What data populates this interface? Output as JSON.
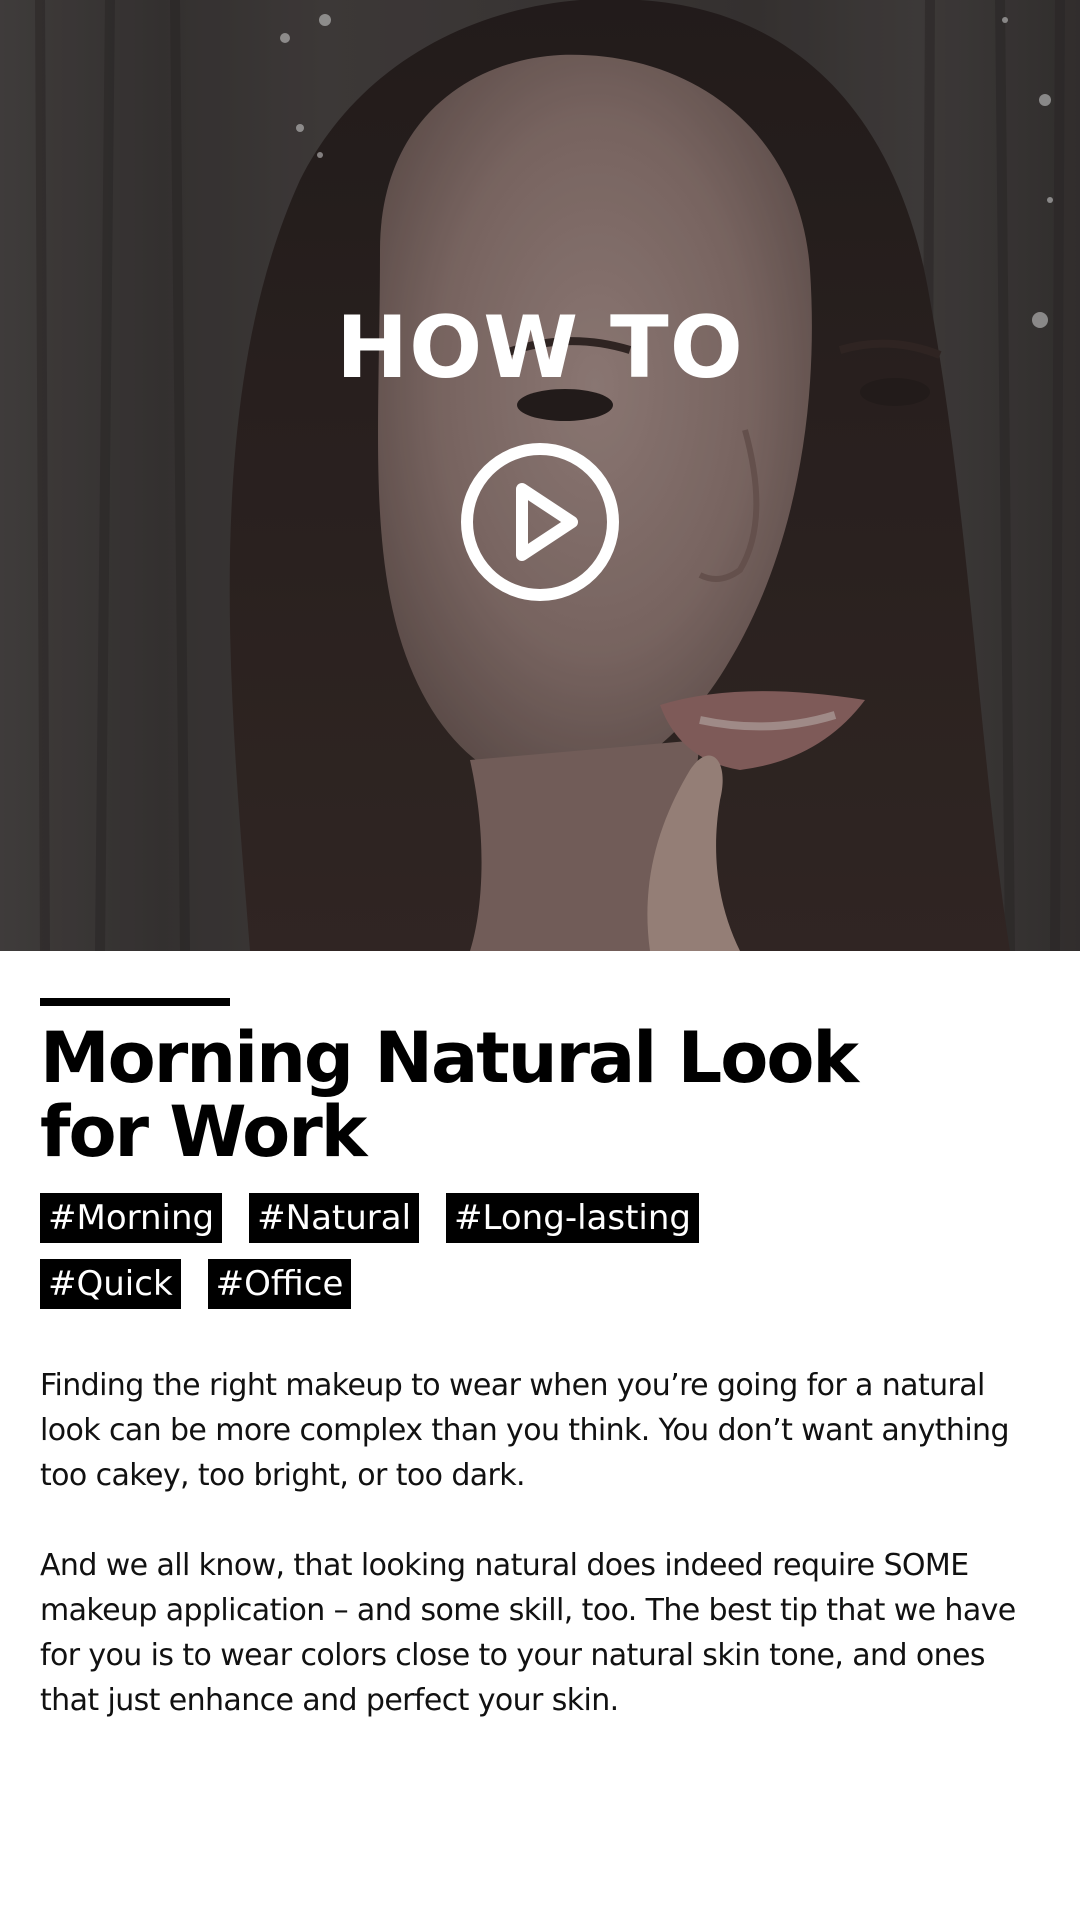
{
  "hero": {
    "heading": "HOW TO",
    "play_icon": "play-circle-icon"
  },
  "article": {
    "title_line1": "Morning Natural Look",
    "title_line2": "for Work",
    "tags_row1": [
      "#Morning",
      "#Natural",
      "#Long-lasting"
    ],
    "tags_row2": [
      "#Quick",
      "#Office"
    ],
    "paragraph1": "Finding the right makeup to wear when you’re going for a natural look can be more complex than you think. You don’t want anything too cakey, too bright, or too dark.",
    "paragraph2": "And we all know, that looking natural does indeed require SOME makeup application – and some skill, too. The best tip that we have for you is to wear colors close to your natural skin tone, and ones that just enhance and perfect your skin."
  },
  "colors": {
    "tag_background": "#000000",
    "tag_text": "#ffffff",
    "title_rule": "#000000",
    "hero_overlay_text": "#ffffff"
  }
}
